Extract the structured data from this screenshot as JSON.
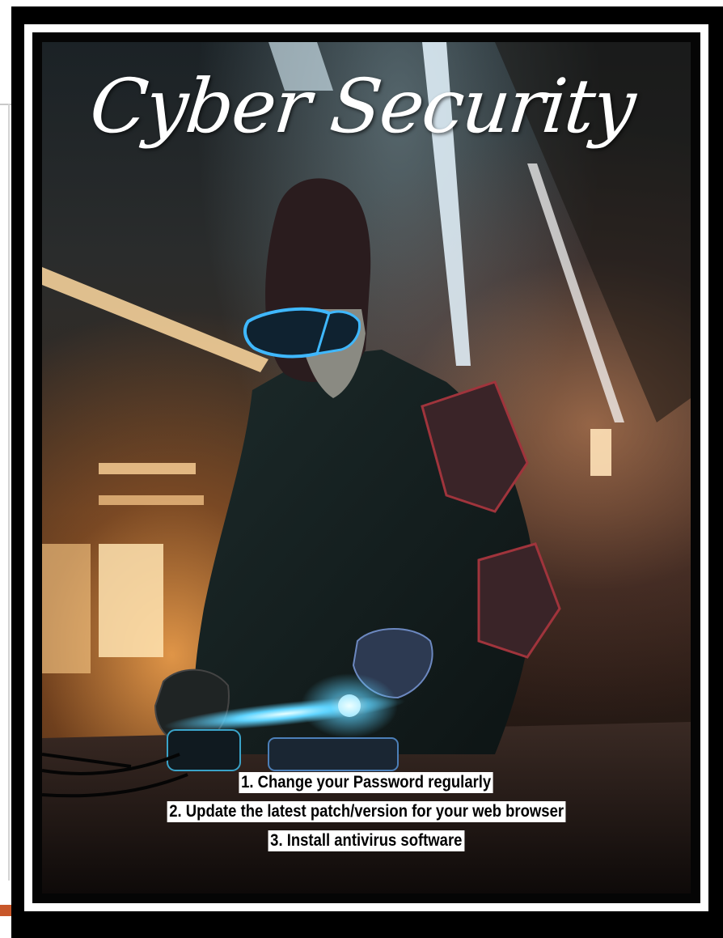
{
  "poster": {
    "title": "Cyber Security",
    "tips": [
      "1. Change your Password regularly",
      "2. Update the latest patch/version for your web browser",
      "3. Install antivirus software"
    ]
  },
  "colors": {
    "slide_accent_bar": "#c8572a",
    "frame": "#000000",
    "goggle_glow": "#3fb8ff",
    "light_beam": "#7fe3ff"
  }
}
